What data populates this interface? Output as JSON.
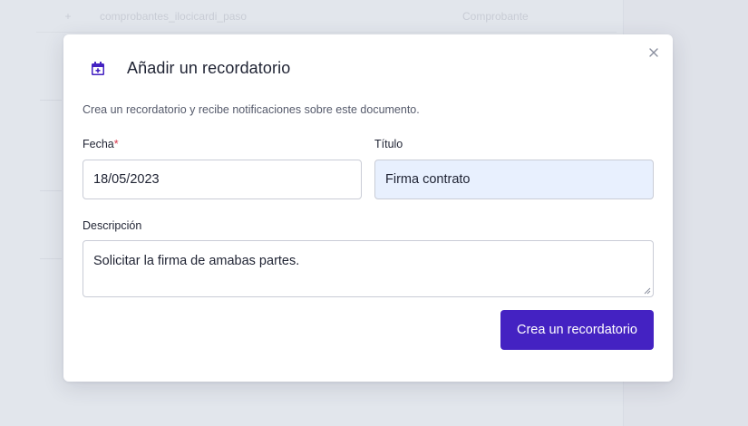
{
  "background": {
    "row_name": "comprobantes_ilocicardi_paso",
    "row_type": "Comprobante"
  },
  "modal": {
    "title": "Añadir un recordatorio",
    "subtitle": "Crea un recordatorio y recibe notificaciones sobre este documento.",
    "icons": {
      "header": "calendar-add-icon",
      "close": "close-icon"
    },
    "fields": {
      "date": {
        "label": "Fecha",
        "required_mark": "*",
        "value": "18/05/2023"
      },
      "title": {
        "label": "Título",
        "value": "Firma contrato"
      },
      "description": {
        "label": "Descripción",
        "value": "Solicitar la firma de amabas partes."
      }
    },
    "submit_label": "Crea un recordatorio"
  },
  "colors": {
    "primary": "#4422c2",
    "required": "#d9364b",
    "autofill": "#e8f0fe"
  }
}
